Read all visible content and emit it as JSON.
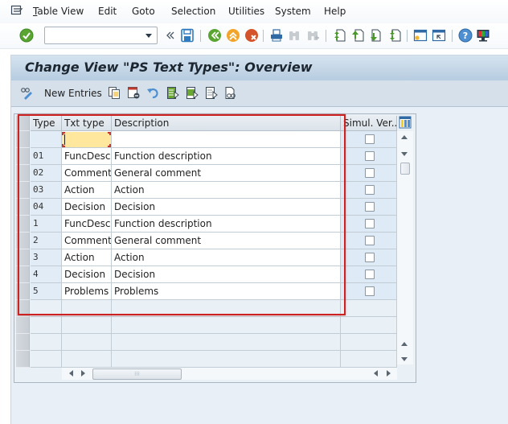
{
  "menubar": {
    "items": [
      {
        "label": "Table View",
        "accel": "T"
      },
      {
        "label": "Edit",
        "accel": "E"
      },
      {
        "label": "Goto",
        "accel": "G"
      },
      {
        "label": "Selection",
        "accel": "l"
      },
      {
        "label": "Utilities",
        "accel": "s"
      },
      {
        "label": "System",
        "accel": "y"
      },
      {
        "label": "Help",
        "accel": "H"
      }
    ]
  },
  "toolbar": {
    "command_field": {
      "value": "",
      "placeholder": ""
    },
    "icons": [
      "enter-icon",
      "command-dropdown",
      "collapse-icon",
      "save-icon",
      "back-icon",
      "exit-icon",
      "cancel-icon",
      "print-icon",
      "find-icon",
      "find-next-icon",
      "first-page-icon",
      "previous-page-icon",
      "next-page-icon",
      "last-page-icon",
      "create-session-icon",
      "shortcut-icon",
      "help-icon",
      "customize-layout-icon"
    ]
  },
  "page": {
    "title": "Change View \"PS Text Types\": Overview"
  },
  "app_toolbar": {
    "new_entries_label": "New Entries",
    "icons": [
      "new-entries-icon",
      "copy-as-icon",
      "delete-icon",
      "undo-change-icon",
      "select-all-icon",
      "select-block-icon",
      "deselect-all-icon",
      "display-other-view-icon"
    ]
  },
  "table": {
    "columns": [
      {
        "key": "type",
        "label": "Type"
      },
      {
        "key": "txt_type",
        "label": "Txt type"
      },
      {
        "key": "description",
        "label": "Description"
      },
      {
        "key": "simul_ver",
        "label": "Simul. Ver..."
      }
    ],
    "new_row": {
      "type": "",
      "txt_type": "",
      "description": "",
      "simul_ver": false
    },
    "rows": [
      {
        "type": "01",
        "txt_type": "FuncDesc",
        "description": "Function description",
        "simul_ver": false
      },
      {
        "type": "02",
        "txt_type": "Comment",
        "description": "General comment",
        "simul_ver": false
      },
      {
        "type": "03",
        "txt_type": "Action",
        "description": "Action",
        "simul_ver": false
      },
      {
        "type": "04",
        "txt_type": "Decision",
        "description": "Decision",
        "simul_ver": false
      },
      {
        "type": "1",
        "txt_type": "FuncDesc",
        "description": "Function description",
        "simul_ver": false
      },
      {
        "type": "2",
        "txt_type": "Comment",
        "description": "General comment",
        "simul_ver": false
      },
      {
        "type": "3",
        "txt_type": "Action",
        "description": "Action",
        "simul_ver": false
      },
      {
        "type": "4",
        "txt_type": "Decision",
        "description": "Decision",
        "simul_ver": false
      },
      {
        "type": "5",
        "txt_type": "Problems",
        "description": "Problems",
        "simul_ver": false
      }
    ],
    "empty_rows": 4
  },
  "colors": {
    "highlight_box": "#cc2222",
    "focused_input": "#ffe79e",
    "title_bar": "#c3d5e6"
  }
}
